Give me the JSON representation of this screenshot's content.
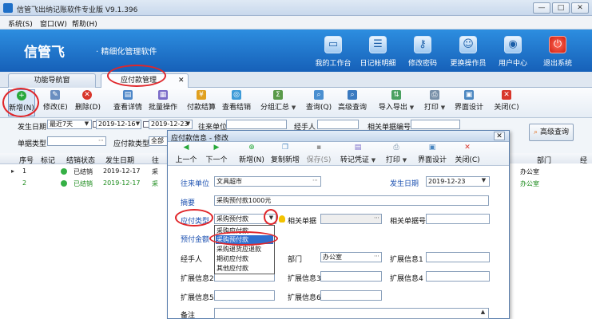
{
  "window": {
    "title": "信管飞出纳记账软件专业版 V9.1.396",
    "minimize": "—",
    "maximize": "□",
    "close": "✕"
  },
  "menu": [
    "系统(S)",
    "窗口(W)",
    "帮助(H)"
  ],
  "banner": {
    "logo": "信管飞",
    "slogan": "· 精细化管理软件",
    "nav": [
      {
        "label": "我的工作台",
        "icon": "monitor-icon"
      },
      {
        "label": "日记帐明细",
        "icon": "ledger-icon"
      },
      {
        "label": "修改密码",
        "icon": "key-icon"
      },
      {
        "label": "更换操作员",
        "icon": "switch-user-icon"
      },
      {
        "label": "用户中心",
        "icon": "globe-icon"
      },
      {
        "label": "退出系统",
        "icon": "power-icon"
      }
    ]
  },
  "tabs": [
    {
      "label": "功能导航窗"
    },
    {
      "label": "应付款管理",
      "close": "✕"
    }
  ],
  "toolbar": [
    {
      "label": "新增(N)",
      "icon": "plus-icon",
      "color": "#27a83a"
    },
    {
      "label": "修改(E)",
      "icon": "edit-icon",
      "color": "#6a8ec0"
    },
    {
      "label": "删除(D)",
      "icon": "delete-icon",
      "color": "#d8362b"
    },
    {
      "label": "查看详情",
      "icon": "details-icon",
      "color": "#4c86c8"
    },
    {
      "label": "批量操作",
      "icon": "batch-icon",
      "color": "#7a6bc8"
    },
    {
      "label": "付款结算",
      "icon": "payment-icon",
      "color": "#e0a020"
    },
    {
      "label": "查看结销",
      "icon": "view-settle-icon",
      "color": "#3e9bd8"
    },
    {
      "label": "分组汇总",
      "icon": "group-sum-icon",
      "color": "#5a9a4a"
    },
    {
      "label": "查询(Q)",
      "icon": "query-icon",
      "color": "#4a8fd0"
    },
    {
      "label": "高级查询",
      "icon": "advanced-query-icon",
      "color": "#3b7ac0"
    },
    {
      "label": "导入导出",
      "icon": "import-export-icon",
      "color": "#4aa060"
    },
    {
      "label": "打印",
      "icon": "print-icon",
      "color": "#7890a8"
    },
    {
      "label": "界面设计",
      "icon": "layout-icon",
      "color": "#4a86c0"
    },
    {
      "label": "关闭(C)",
      "icon": "close-red-icon",
      "color": "#d8362b"
    }
  ],
  "filter": {
    "date_label": "发生日期",
    "date_range": "最近7天",
    "date_from": "2019-12-16",
    "date_to": "2019-12-23",
    "vendor_label": "往来单位",
    "handler_label": "经手人",
    "related_no_label": "相关单据编号",
    "doc_type_label": "单据类型",
    "pay_type_label": "应付款类型",
    "pay_type_value": "全部",
    "advanced_query": "高级查询"
  },
  "grid": {
    "headers": [
      "序号",
      "标记",
      "结销状态",
      "发生日期",
      "往",
      "部门",
      "经"
    ],
    "rows": [
      {
        "no": "1",
        "mark": "▸",
        "status": "已结销",
        "date": "2019-12-17",
        "vendor": "采",
        "dept": "办公室"
      },
      {
        "no": "2",
        "mark": "",
        "status": "已结销",
        "date": "2019-12-17",
        "vendor": "采",
        "dept": "办公室"
      }
    ]
  },
  "dialog": {
    "title": "应付款信息 - 修改",
    "close": "✕",
    "toolbar": [
      {
        "label": "上一个",
        "icon": "prev-arrow-icon",
        "color": "#27a83a"
      },
      {
        "label": "下一个",
        "icon": "next-arrow-icon",
        "color": "#27a83a"
      },
      {
        "label": "新增(N)",
        "icon": "plus-icon",
        "color": "#27a83a"
      },
      {
        "label": "复制新增",
        "icon": "copy-icon",
        "color": "#4a86c0"
      },
      {
        "label": "保存(S)",
        "icon": "save-icon",
        "color": "#999999"
      },
      {
        "label": "转记凭证",
        "icon": "voucher-icon",
        "color": "#7a6bc8"
      },
      {
        "label": "打印",
        "icon": "print-icon",
        "color": "#7890a8"
      },
      {
        "label": "界面设计",
        "icon": "layout-icon",
        "color": "#4a86c0"
      },
      {
        "label": "关闭(C)",
        "icon": "close-red-icon",
        "color": "#d8362b"
      }
    ],
    "fields": {
      "vendor_label": "往来单位",
      "vendor_value": "文具超市",
      "date_label": "发生日期",
      "date_value": "2019-12-23",
      "summary_label": "摘要",
      "summary_value": "采购预付款1000元",
      "pay_type_label": "应付类型",
      "pay_type_value": "采购预付款",
      "related_doc_label": "相关单据",
      "related_no_label": "相关单据号",
      "amount_label": "预付金额",
      "handler_label": "经手人",
      "dept_label": "部门",
      "dept_value": "办公室",
      "ext1_label": "扩展信息1",
      "ext2_label": "扩展信息2",
      "ext3_label": "扩展信息3",
      "ext4_label": "扩展信息4",
      "ext5_label": "扩展信息5",
      "ext6_label": "扩展信息6",
      "note_label": "备注"
    },
    "dropdown_options": [
      "采购应付款",
      "采购预付款",
      "采购退货应退款",
      "期初应付款",
      "其他应付款"
    ],
    "dropdown_selected_index": 1
  },
  "colors": {
    "accent": "#1660b8",
    "annotation_ring": "#e0262a",
    "settled_dot": "#35b045",
    "row_text": "#1a8a1a"
  }
}
